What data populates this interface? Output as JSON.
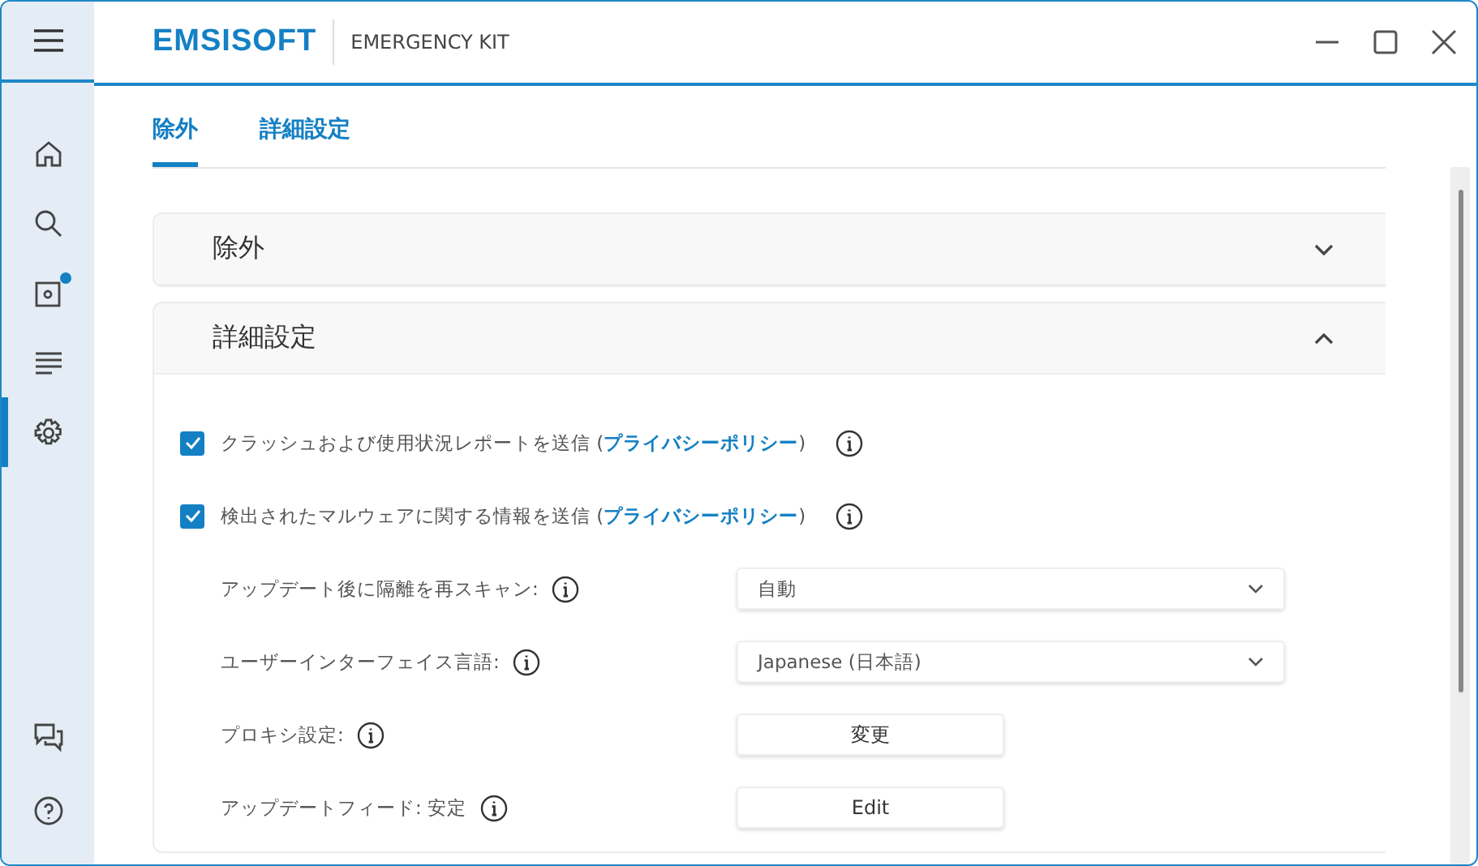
{
  "window": {
    "brand": "EMSISOFT",
    "product": "EMERGENCY KIT"
  },
  "sidebar": {
    "items": [
      {
        "selected": false,
        "badge": false
      },
      {
        "selected": false,
        "badge": false
      },
      {
        "selected": false,
        "badge": true
      },
      {
        "selected": false,
        "badge": false
      },
      {
        "selected": true,
        "badge": false
      }
    ],
    "bottom_items": [
      {
        "selected": false
      },
      {
        "selected": false
      }
    ]
  },
  "tabs": [
    {
      "label": "除外",
      "selected": true
    },
    {
      "label": "詳細設定",
      "selected": false
    }
  ],
  "sections": [
    {
      "title": "除外",
      "expanded": false
    },
    {
      "title": "詳細設定",
      "expanded": true
    }
  ],
  "settings": [
    {
      "kind": "checkbox",
      "label": "クラッシュおよび使用状況レポートを送信 (",
      "link": "プライバシーポリシー",
      "suffix": ")",
      "checked": true
    },
    {
      "kind": "checkbox",
      "label": "検出されたマルウェアに関する情報を送信 (",
      "link": "プライバシーポリシー",
      "suffix": ")",
      "checked": true
    },
    {
      "kind": "select",
      "label": "アップデート後に隔離を再スキャン:",
      "value": "自動"
    },
    {
      "kind": "select",
      "label": "ユーザーインターフェイス言語:",
      "value": "Japanese (日本語)"
    },
    {
      "kind": "button",
      "label": "プロキシ設定:",
      "button": "変更"
    },
    {
      "kind": "button",
      "label": "アップデートフィード: 安定",
      "button": "Edit"
    }
  ]
}
